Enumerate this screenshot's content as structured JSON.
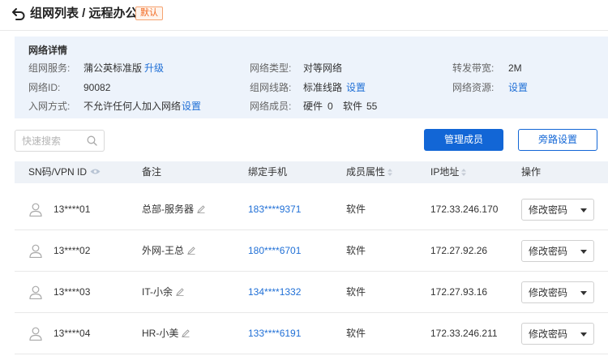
{
  "header": {
    "title": "组网列表 / 远程办公",
    "badge": "默认",
    "icons": {
      "back": "back-arrow-icon"
    }
  },
  "details": {
    "title": "网络详情",
    "service_label": "组网服务:",
    "service_value": "蒲公英标准版",
    "upgrade_link": "升级",
    "network_type_label": "网络类型:",
    "network_type_value": "对等网络",
    "bandwidth_label": "转发带宽:",
    "bandwidth_value": "2M",
    "network_id_label": "网络ID:",
    "network_id_value": "90082",
    "route_label": "组网线路:",
    "route_value": "标准线路",
    "route_setting_link": "设置",
    "resource_label": "网络资源:",
    "resource_setting_link": "设置",
    "join_label": "入网方式:",
    "join_value": "不允许任何人加入网络",
    "join_setting_link": "设置",
    "members_label": "网络成员:",
    "hardware_label": "硬件",
    "hardware_count": "0",
    "software_label": "软件",
    "software_count": "55"
  },
  "toolbar": {
    "search_placeholder": "快速搜索",
    "manage_members": "管理成员",
    "bypass_settings": "旁路设置"
  },
  "table": {
    "columns": {
      "sn": "SN码/VPN ID",
      "remark": "备注",
      "phone": "绑定手机",
      "member_attr": "成员属性",
      "ip": "IP地址",
      "action": "操作"
    },
    "rows": [
      {
        "sn": "13****01",
        "remark": "总部-服务器",
        "phone": "183****9371",
        "attr": "软件",
        "ip": "172.33.246.170",
        "action": "修改密码"
      },
      {
        "sn": "13****02",
        "remark": "外网-王总",
        "phone": "180****6701",
        "attr": "软件",
        "ip": "172.27.92.26",
        "action": "修改密码"
      },
      {
        "sn": "13****03",
        "remark": "IT-小余",
        "phone": "134****1332",
        "attr": "软件",
        "ip": "172.27.93.16",
        "action": "修改密码"
      },
      {
        "sn": "13****04",
        "remark": "HR-小美",
        "phone": "133****6191",
        "attr": "软件",
        "ip": "172.33.246.211",
        "action": "修改密码"
      }
    ]
  },
  "colors": {
    "primary": "#1266d6",
    "link": "#1f6fd6",
    "badge_text": "#f26a22",
    "details_bg": "#edf3fb",
    "table_head_bg": "#eef2f7"
  }
}
